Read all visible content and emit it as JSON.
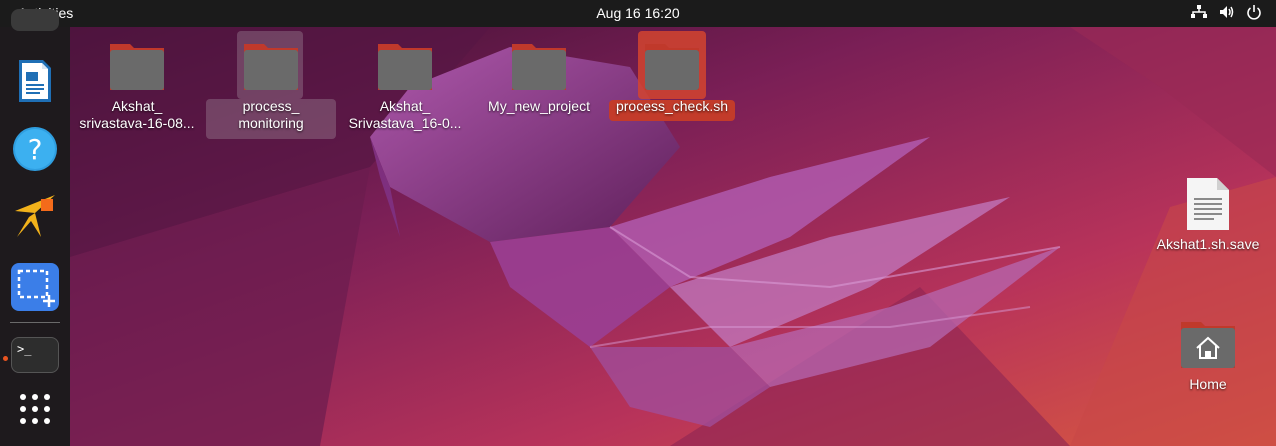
{
  "topbar": {
    "activities": "Activities",
    "clock": "Aug 16  16:20",
    "tray_icons": [
      "network-icon",
      "volume-icon",
      "power-icon"
    ]
  },
  "dock": {
    "apps": [
      {
        "name": "libreoffice-writer-icon"
      },
      {
        "name": "help-icon"
      },
      {
        "name": "anydesk-like-icon"
      },
      {
        "name": "screenshot-icon"
      },
      {
        "name": "terminal-icon",
        "running": true
      },
      {
        "name": "show-apps-icon"
      }
    ]
  },
  "desktop": {
    "items": [
      {
        "label_line1": "Akshat_",
        "label_line2": "srivastava-16-08..."
      },
      {
        "label_line1": "process_",
        "label_line2": "monitoring"
      },
      {
        "label_line1": "Akshat_",
        "label_line2": "Srivastava_16-0..."
      },
      {
        "label_line1": "My_new_project",
        "label_line2": ""
      },
      {
        "label_line1": "process_check.sh",
        "label_line2": ""
      },
      {
        "label_line1": "Akshat1.sh.save",
        "label_line2": ""
      },
      {
        "label_line1": "Home",
        "label_line2": ""
      }
    ],
    "selected_accent": "#e95420"
  }
}
